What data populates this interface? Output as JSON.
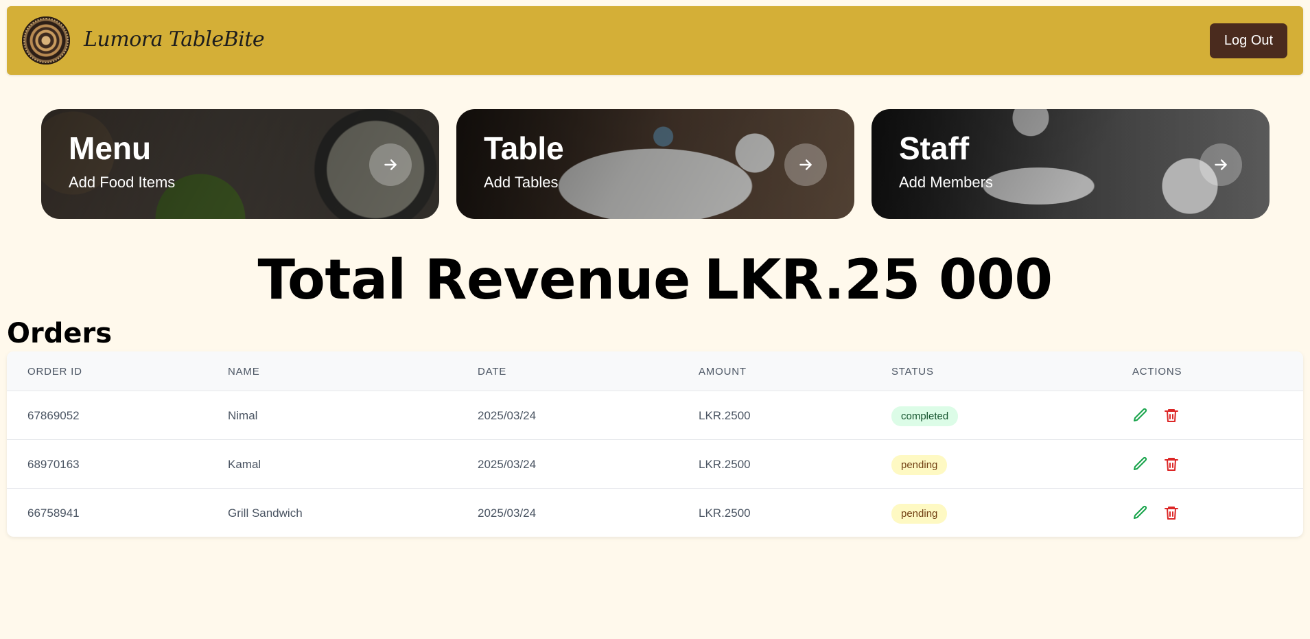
{
  "header": {
    "brand": "Lumora TableBite",
    "logout_label": "Log Out",
    "accent": "#d4af37",
    "logout_color": "#4a2b1e"
  },
  "cards": [
    {
      "title": "Menu",
      "subtitle": "Add Food Items",
      "icon": "arrow-right-icon"
    },
    {
      "title": "Table",
      "subtitle": "Add Tables",
      "icon": "arrow-right-icon"
    },
    {
      "title": "Staff",
      "subtitle": "Add Members",
      "icon": "arrow-right-icon"
    }
  ],
  "revenue": {
    "label": "Total Revenue",
    "value": "LKR.25 000"
  },
  "orders": {
    "title": "Orders",
    "columns": [
      "ORDER ID",
      "NAME",
      "DATE",
      "AMOUNT",
      "STATUS",
      "ACTIONS"
    ],
    "rows": [
      {
        "order_id": "67869052",
        "name": "Nimal",
        "date": "2025/03/24",
        "amount": "LKR.2500",
        "status": "completed"
      },
      {
        "order_id": "68970163",
        "name": "Kamal",
        "date": "2025/03/24",
        "amount": "LKR.2500",
        "status": "pending"
      },
      {
        "order_id": "66758941",
        "name": "Grill Sandwich",
        "date": "2025/03/24",
        "amount": "LKR.2500",
        "status": "pending"
      }
    ],
    "action_icons": [
      "edit-icon",
      "delete-icon"
    ],
    "status_colors": {
      "completed": "#dcfce7",
      "pending": "#fef9c3"
    }
  }
}
